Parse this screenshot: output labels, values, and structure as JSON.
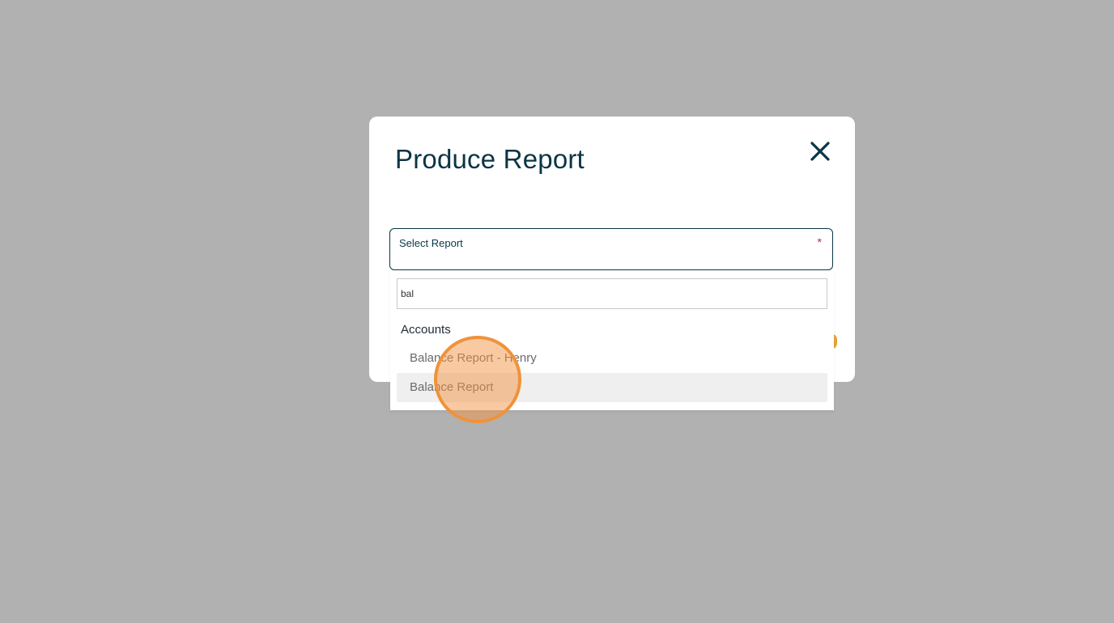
{
  "modal": {
    "title": "Produce Report",
    "close_icon": "close-icon"
  },
  "select_report": {
    "label": "Select Report",
    "required_mark": "*"
  },
  "dropdown": {
    "search_value": "bal",
    "groups": [
      {
        "label": "Accounts",
        "options": [
          {
            "label": "Balance Report - Henry",
            "highlighted": false
          },
          {
            "label": "Balance Report",
            "highlighted": true
          }
        ]
      }
    ]
  },
  "colors": {
    "backdrop": "#b1b1b1",
    "title_text": "#0b3545",
    "required": "#c8203a",
    "click_indicator": "#f0923a",
    "option_highlight": "#efefef"
  }
}
